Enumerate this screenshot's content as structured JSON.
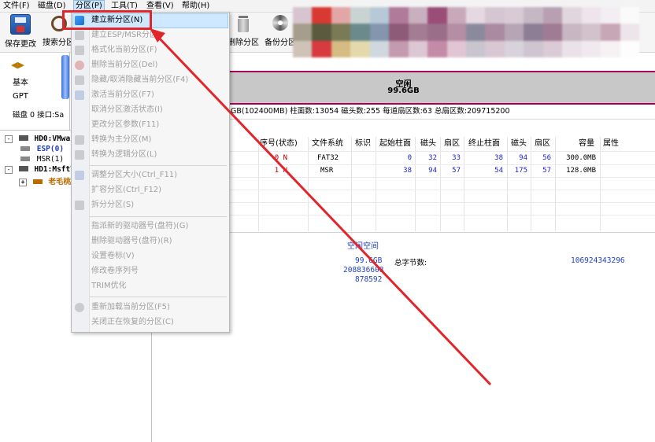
{
  "menubar": {
    "items": [
      "文件(F)",
      "磁盘(D)",
      "分区(P)",
      "工具(T)",
      "查看(V)",
      "帮助(H)"
    ]
  },
  "toolbar": {
    "save": "保存更改",
    "search": "搜索分区",
    "delete": "删除分区",
    "backup": "备份分区"
  },
  "left_panel": {
    "basic": "基本",
    "gpt": "GPT",
    "disk_label": "磁盘 0 接口:Sa"
  },
  "tree": {
    "hd0": "HD0:VMwa",
    "esp": "ESP(0)",
    "msr": "MSR(1)",
    "hd1": "HD1:MsftV",
    "laomao": "老毛桃"
  },
  "disk_bar": {
    "label": "空闲",
    "size": "99.6GB"
  },
  "disk_info": "GB(102400MB)  柱面数:13054  磁头数:255  每道扇区数:63  总扇区数:209715200",
  "table": {
    "headers": [
      "序号(状态)",
      "文件系统",
      "标识",
      "起始柱面",
      "磁头",
      "扇区",
      "终止柱面",
      "磁头",
      "扇区",
      "容量",
      "属性"
    ],
    "rows": [
      [
        "0 N",
        "FAT32",
        "",
        "0",
        "32",
        "33",
        "38",
        "94",
        "56",
        "300.0MB",
        ""
      ],
      [
        "1 N",
        "MSR",
        "",
        "38",
        "94",
        "57",
        "54",
        "175",
        "57",
        "128.0MB",
        ""
      ]
    ]
  },
  "detail": {
    "title": "空闲空间",
    "size": "99.6GB",
    "total_bytes_label": "总字节数:",
    "total_bytes": "106924343296",
    "val1": "208836608",
    "val2": "878592"
  },
  "dropdown": {
    "items": [
      {
        "label": "建立新分区(N)",
        "enabled": true
      },
      {
        "label": "建立ESP/MSR分区",
        "enabled": false
      },
      {
        "label": "格式化当前分区(F)",
        "enabled": false
      },
      {
        "label": "删除当前分区(Del)",
        "enabled": false
      },
      {
        "label": "隐藏/取消隐藏当前分区(F4)",
        "enabled": false
      },
      {
        "label": "激活当前分区(F7)",
        "enabled": false
      },
      {
        "label": "取消分区激活状态(I)",
        "enabled": false
      },
      {
        "label": "更改分区参数(F11)",
        "enabled": false
      },
      {
        "label": "转换为主分区(M)",
        "enabled": false
      },
      {
        "label": "转换为逻辑分区(L)",
        "enabled": false
      },
      {
        "label": "调整分区大小(Ctrl_F11)",
        "enabled": false
      },
      {
        "label": "扩容分区(Ctrl_F12)",
        "enabled": false
      },
      {
        "label": "拆分分区(S)",
        "enabled": false
      },
      {
        "label": "指派新的驱动器号(盘符)(G)",
        "enabled": false
      },
      {
        "label": "删除驱动器号(盘符)(R)",
        "enabled": false
      },
      {
        "label": "设置卷标(V)",
        "enabled": false
      },
      {
        "label": "修改卷序列号",
        "enabled": false
      },
      {
        "label": "TRIM优化",
        "enabled": false
      },
      {
        "label": "重新加载当前分区(F5)",
        "enabled": false
      },
      {
        "label": "关闭正在恢复的分区(C)",
        "enabled": false
      }
    ]
  },
  "colors": {
    "annotation_red": "#e2252b",
    "disk_border": "#a8005b",
    "highlight": "#cde8ff"
  }
}
